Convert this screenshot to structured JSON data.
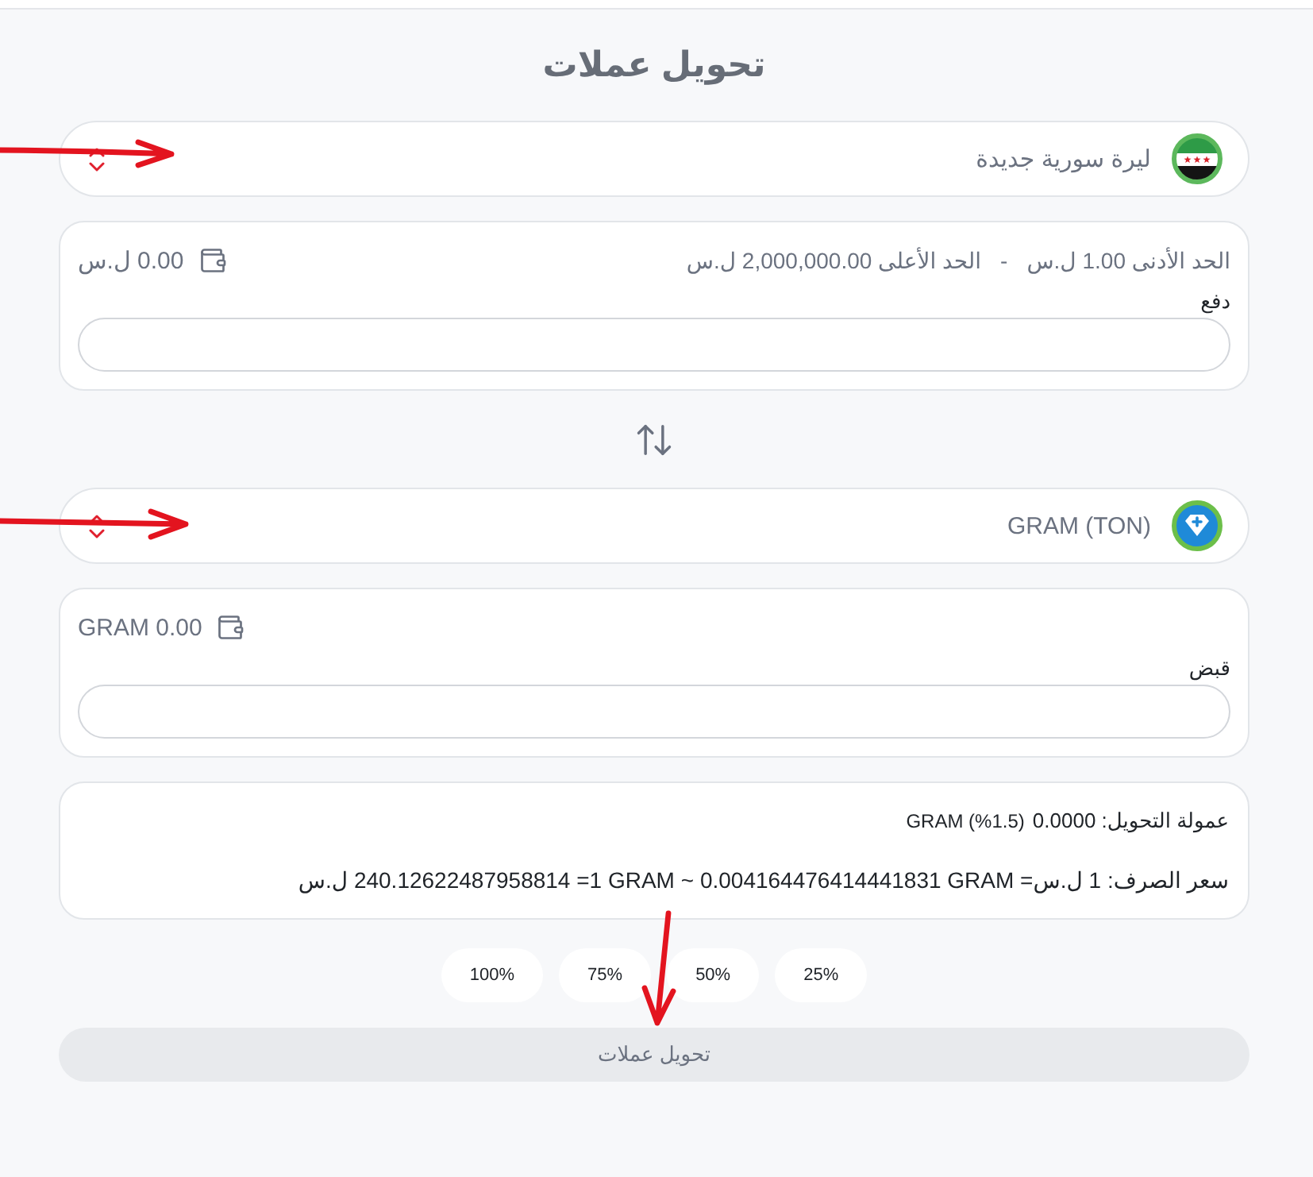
{
  "title": "تحويل عملات",
  "pay": {
    "currency": {
      "kind": "flag",
      "name": "ليرة سورية جديدة"
    },
    "limits": {
      "min": "الحد الأدنى 1.00 ل.س",
      "separator": "-",
      "max": "الحد الأعلى 2,000,000.00 ل.س"
    },
    "balance": "0.00 ل.س",
    "label": "دفع"
  },
  "receive": {
    "currency": {
      "kind": "token",
      "name": "GRAM (TON)"
    },
    "balance": "0.00 GRAM",
    "label": "قبض"
  },
  "summary": {
    "fee": {
      "text": "عمولة التحويل: 0.0000",
      "detail": "(1.5%) GRAM"
    },
    "rate": "سعر الصرف: 1 ل.س= ⁦0.004164476414441831 GRAM⁩ ~ ⁦1 GRAM⁩= 240.12622487958814 ل.س"
  },
  "percent_buttons": [
    "25%",
    "50%",
    "75%",
    "100%"
  ],
  "submit": {
    "label": "تحويل عملات",
    "disabled": true
  }
}
